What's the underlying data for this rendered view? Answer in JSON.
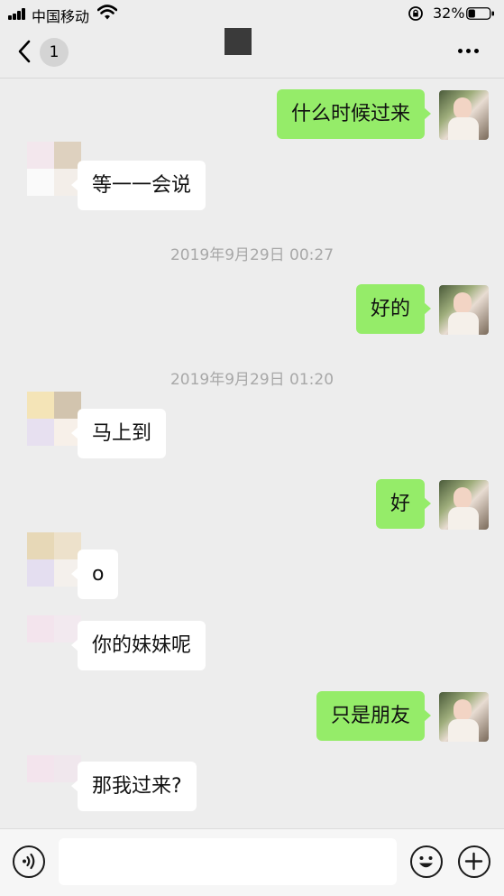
{
  "status_bar": {
    "carrier": "中国移动",
    "battery_percent": "32%",
    "battery_level": 0.32
  },
  "nav": {
    "unread_count": "1"
  },
  "messages": [
    {
      "side": "right",
      "text": "什么时候过来"
    },
    {
      "side": "left",
      "text": "等一一会说"
    },
    {
      "type": "timestamp",
      "text": "2019年9月29日 00:27"
    },
    {
      "side": "right",
      "text": "好的"
    },
    {
      "type": "timestamp",
      "text": "2019年9月29日 01:20"
    },
    {
      "side": "left",
      "text": "马上到"
    },
    {
      "side": "right",
      "text": "好"
    },
    {
      "side": "left",
      "text": "o"
    },
    {
      "side": "left",
      "text": "你的妹妹呢"
    },
    {
      "side": "right",
      "text": "只是朋友"
    },
    {
      "side": "left",
      "text": "那我过来?"
    }
  ],
  "input_bar": {
    "text_value": "",
    "icons": [
      "voice-icon",
      "emoji-icon",
      "plus-icon"
    ]
  },
  "colors": {
    "outgoing_bubble": "#95ec69",
    "incoming_bubble": "#ffffff",
    "background": "#ededed"
  }
}
